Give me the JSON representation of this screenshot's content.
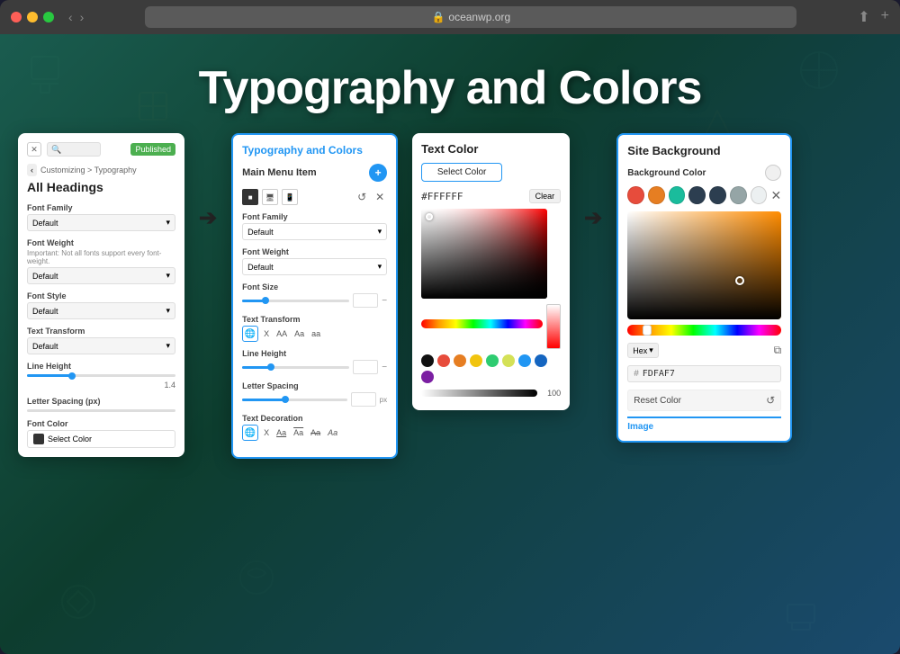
{
  "browser": {
    "url": "oceanwp.org",
    "lock_icon": "🔒"
  },
  "page": {
    "title": "Typography and Colors"
  },
  "panel1": {
    "title": "All Headings",
    "breadcrumb": "Customizing > Typography",
    "published": "Published",
    "font_family_label": "Font Family",
    "font_family_value": "Default",
    "font_weight_label": "Font Weight",
    "font_weight_note": "Important: Not all fonts support every font-weight.",
    "font_weight_value": "Default",
    "font_style_label": "Font Style",
    "font_style_value": "Default",
    "text_transform_label": "Text Transform",
    "text_transform_value": "Default",
    "line_height_label": "Line Height",
    "line_height_value": "1.4",
    "letter_spacing_label": "Letter Spacing (px)",
    "font_color_label": "Font Color",
    "select_color_btn": "Select Color"
  },
  "panel2": {
    "title": "Typography and Colors",
    "menu_item_label": "Main Menu Item",
    "font_family_label": "Font Family",
    "font_family_value": "Default",
    "font_weight_label": "Font Weight",
    "font_weight_value": "Default",
    "font_size_label": "Font Size",
    "text_transform_label": "Text Transform",
    "transform_opts": [
      "X",
      "AA",
      "Aa",
      "aa"
    ],
    "line_height_label": "Line Height",
    "letter_spacing_label": "Letter Spacing",
    "px_label": "px",
    "text_decoration_label": "Text Decoration",
    "dec_opts": [
      "X",
      "Aa",
      "Aa",
      "Aa",
      "Aa"
    ]
  },
  "panel3": {
    "title": "Text Color",
    "select_color_btn": "Select Color",
    "hex_value": "#FFFFFF",
    "clear_btn": "Clear",
    "opacity_value": "100",
    "presets": [
      "#ff4444",
      "#ff8844",
      "#ffcc44",
      "#88cc44",
      "#44cc88",
      "#4488ff",
      "#8844ff",
      "#ffffff",
      "#000000"
    ]
  },
  "panel4": {
    "title": "Site Background",
    "bg_color_label": "Background Color",
    "hex_label": "Hex",
    "hex_value": "FDFAF7",
    "reset_color_btn": "Reset Color",
    "image_tab": "Image",
    "swatches": [
      "#e74c3c",
      "#e67e22",
      "#1abc9c",
      "#16a085",
      "#2c3e50",
      "#95a5a6",
      "#ecf0f1"
    ]
  },
  "arrows": {
    "right": "➔"
  }
}
